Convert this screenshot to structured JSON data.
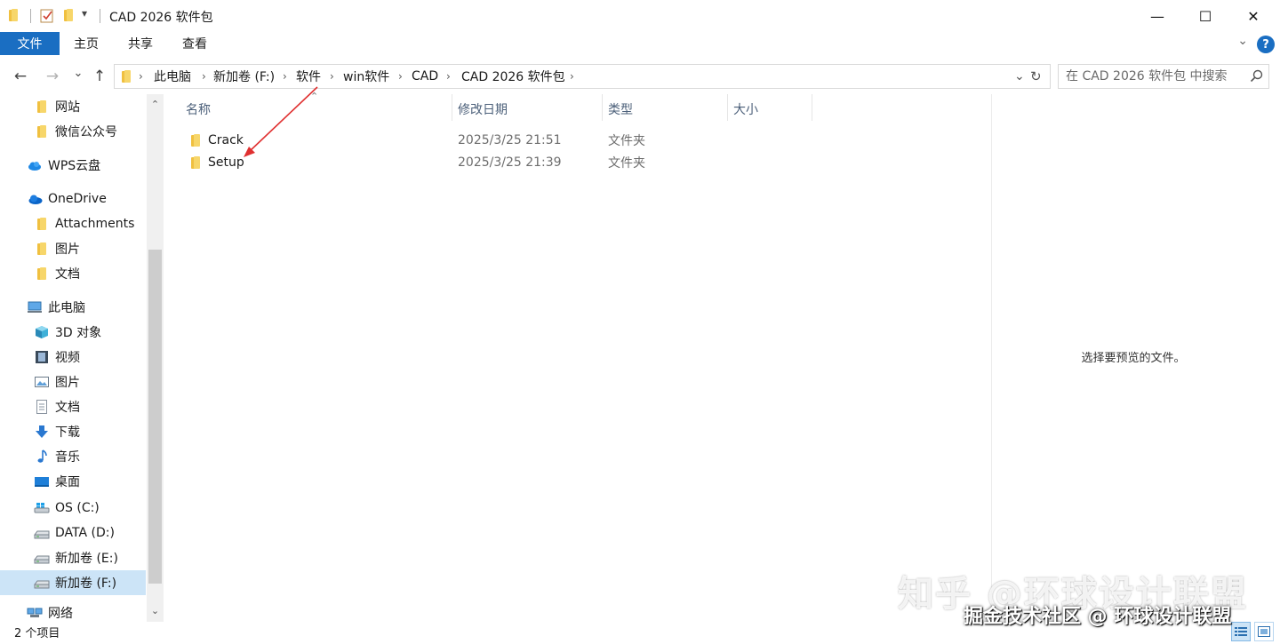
{
  "window": {
    "title": "CAD 2026 软件包",
    "minimize": "—",
    "maximize": "☐",
    "close": "✕"
  },
  "ribbon": {
    "tabs": [
      "文件",
      "主页",
      "共享",
      "查看"
    ],
    "help": "?"
  },
  "nav": {
    "back": "←",
    "forward": "→",
    "recent": "⌄",
    "up": "↑",
    "breadcrumbs": [
      "此电脑",
      "新加卷 (F:)",
      "软件",
      "win软件",
      "CAD",
      "CAD 2026 软件包"
    ],
    "search_placeholder": "在 CAD 2026 软件包 中搜索"
  },
  "sidebar": {
    "items": [
      {
        "label": "网站",
        "icon": "folder-icon"
      },
      {
        "label": "微信公众号",
        "icon": "folder-icon"
      },
      {
        "label": "WPS云盘",
        "icon": "cloud-icon"
      },
      {
        "label": "OneDrive",
        "icon": "onedrive-icon"
      },
      {
        "label": "Attachments",
        "icon": "folder-icon"
      },
      {
        "label": "图片",
        "icon": "folder-icon"
      },
      {
        "label": "文档",
        "icon": "folder-icon"
      },
      {
        "label": "此电脑",
        "icon": "computer-icon"
      },
      {
        "label": "3D 对象",
        "icon": "cube-icon"
      },
      {
        "label": "视频",
        "icon": "film-icon"
      },
      {
        "label": "图片",
        "icon": "picture-icon"
      },
      {
        "label": "文档",
        "icon": "document-icon"
      },
      {
        "label": "下载",
        "icon": "download-icon"
      },
      {
        "label": "音乐",
        "icon": "music-icon"
      },
      {
        "label": "桌面",
        "icon": "desktop-icon"
      },
      {
        "label": "OS (C:)",
        "icon": "windows-drive-icon"
      },
      {
        "label": "DATA (D:)",
        "icon": "drive-icon"
      },
      {
        "label": "新加卷 (E:)",
        "icon": "drive-icon"
      },
      {
        "label": "新加卷 (F:)",
        "icon": "drive-icon"
      },
      {
        "label": "网络",
        "icon": "network-icon"
      }
    ],
    "selected_label": "新加卷 (F:)"
  },
  "file_list": {
    "columns": [
      "名称",
      "修改日期",
      "类型",
      "大小"
    ],
    "rows": [
      {
        "name": "Crack",
        "modified": "2025/3/25 21:51",
        "type": "文件夹",
        "size": ""
      },
      {
        "name": "Setup",
        "modified": "2025/3/25 21:39",
        "type": "文件夹",
        "size": ""
      }
    ]
  },
  "preview": {
    "message": "选择要预览的文件。"
  },
  "status": {
    "item_count": "2 个项目"
  },
  "watermark": {
    "zhihu": "知乎 @环球设计联盟",
    "juejin": "掘金技术社区 @ 环球设计联盟"
  },
  "colors": {
    "accent": "#1a6ec2",
    "selection": "#cce4f7",
    "folder": "#f0c040",
    "annotation_arrow": "#e03030"
  }
}
